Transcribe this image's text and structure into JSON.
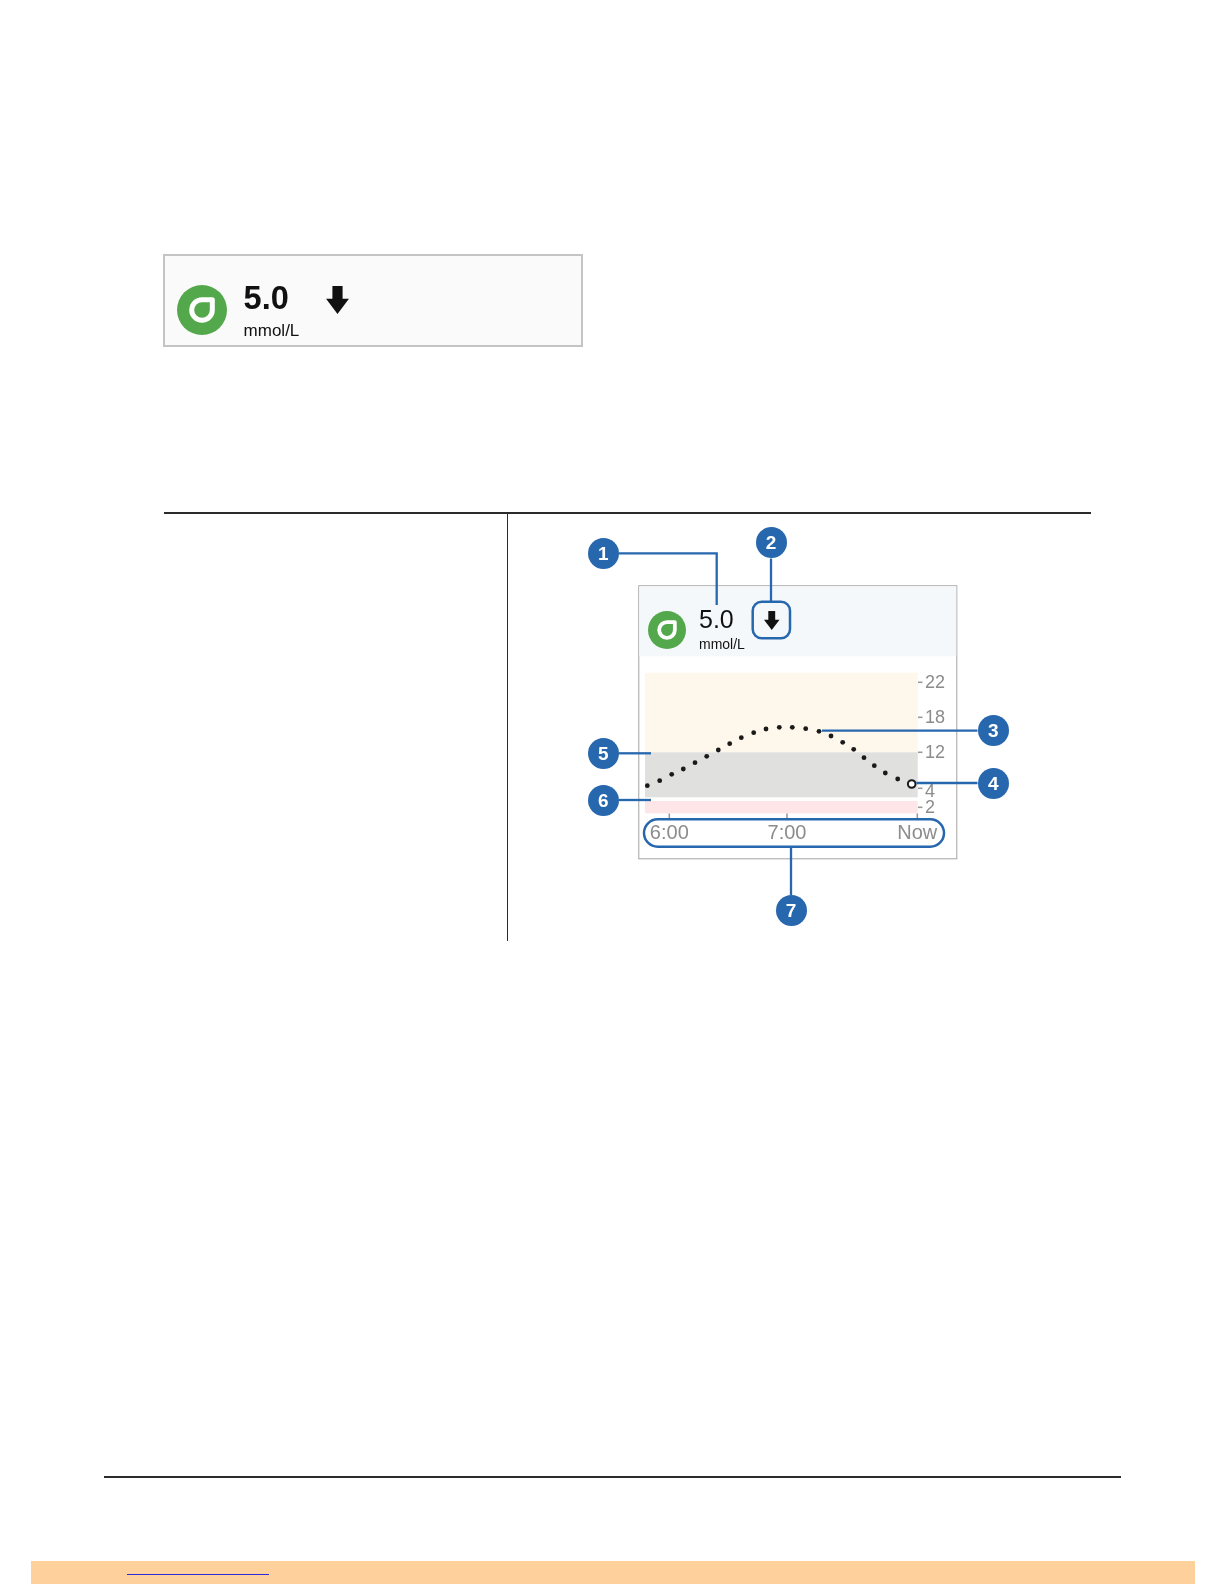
{
  "reading_card": {
    "value": "5.0",
    "unit": "mmol/L"
  },
  "figure": {
    "screen": {
      "value": "5.0",
      "unit": "mmol/L",
      "chart": {
        "y_labels": [
          "22",
          "18",
          "12",
          "4",
          "2"
        ],
        "x_labels": [
          "6:00",
          "7:00",
          "Now"
        ]
      }
    },
    "callouts": [
      {
        "number": "1"
      },
      {
        "number": "2"
      },
      {
        "number": "3"
      },
      {
        "number": "4"
      },
      {
        "number": "5"
      },
      {
        "number": "6"
      },
      {
        "number": "7"
      }
    ]
  }
}
